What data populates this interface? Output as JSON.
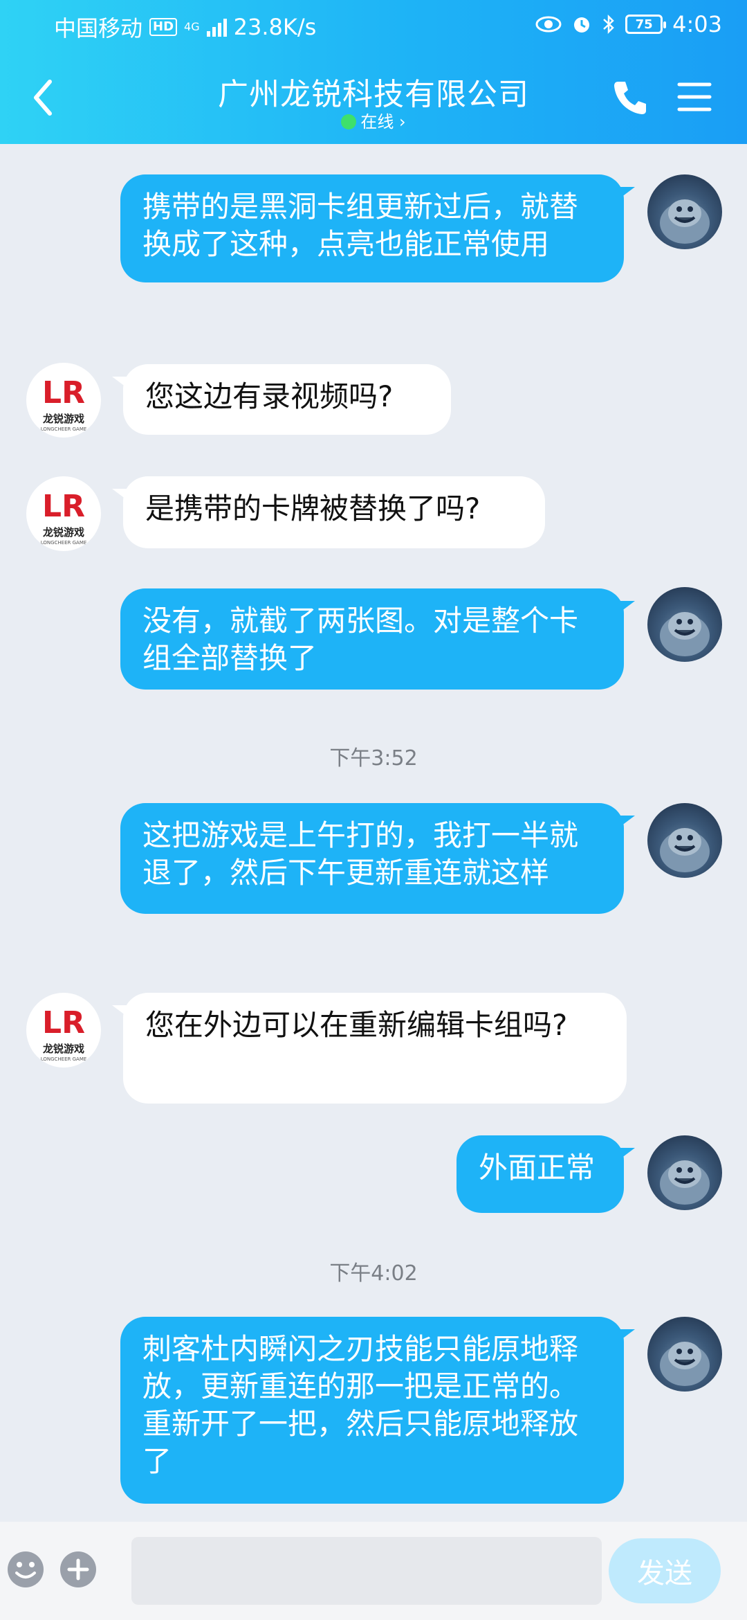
{
  "status_bar": {
    "carrier": "中国移动",
    "hd": "HD",
    "network": "4G",
    "speed": "23.8K/s",
    "battery": "75",
    "time": "4:03"
  },
  "header": {
    "title": "广州龙锐科技有限公司",
    "online": "在线 ›"
  },
  "colors": {
    "header_start": "#2fd2f5",
    "header_end": "#1a9ef5",
    "bubble_me": "#1eb3f7",
    "bubble_them": "#ffffff",
    "online_dot": "#3ee06b",
    "chat_bg": "#e9edf3"
  },
  "messages": [
    {
      "from": "me",
      "text": "携带的是黑洞卡组更新过后，就替换成了这种，点亮也能正常使用"
    },
    {
      "from": "them",
      "text": "您这边有录视频吗?"
    },
    {
      "from": "them",
      "text": "是携带的卡牌被替换了吗?"
    },
    {
      "from": "me",
      "text": "没有，就截了两张图。对是整个卡组全部替换了"
    },
    {
      "from": "time",
      "text": "下午3:52"
    },
    {
      "from": "me",
      "text": "这把游戏是上午打的，我打一半就退了，然后下午更新重连就这样"
    },
    {
      "from": "them",
      "text": "您在外边可以在重新编辑卡组吗?"
    },
    {
      "from": "me",
      "text": "外面正常"
    },
    {
      "from": "time",
      "text": "下午4:02"
    },
    {
      "from": "me",
      "text": "刺客杜内瞬闪之刃技能只能原地释放，更新重连的那一把是正常的。重新开了一把，然后只能原地释放了"
    }
  ],
  "avatar_them": {
    "logo_text": "LR",
    "caption": "龙锐游戏",
    "subcaption": "LONGCHEER GAME"
  },
  "input": {
    "placeholder": "",
    "send_label": "发送"
  },
  "icons": {
    "back": "chevron-left-icon",
    "phone": "phone-icon",
    "menu": "menu-icon",
    "emoji": "emoji-icon",
    "plus": "plus-icon"
  }
}
